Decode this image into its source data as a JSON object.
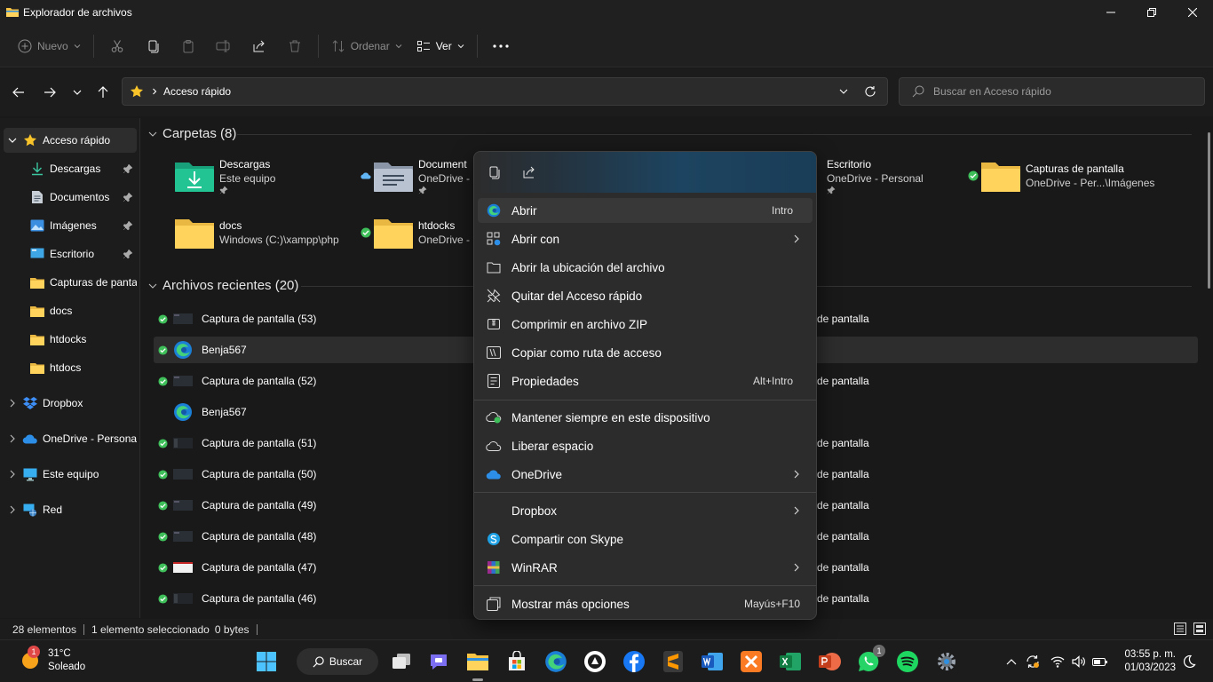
{
  "window": {
    "title": "Explorador de archivos"
  },
  "toolbar": {
    "new_label": "Nuevo",
    "sort_label": "Ordenar",
    "view_label": "Ver"
  },
  "address": {
    "crumb": "Acceso rápido"
  },
  "search": {
    "placeholder": "Buscar en Acceso rápido"
  },
  "sidebar": {
    "items": [
      {
        "label": "Acceso rápido"
      },
      {
        "label": "Descargas"
      },
      {
        "label": "Documentos"
      },
      {
        "label": "Imágenes"
      },
      {
        "label": "Escritorio"
      },
      {
        "label": "Capturas de panta"
      },
      {
        "label": "docs"
      },
      {
        "label": "htdocks"
      },
      {
        "label": "htdocs"
      },
      {
        "label": "Dropbox"
      },
      {
        "label": "OneDrive - Personal"
      },
      {
        "label": "Este equipo"
      },
      {
        "label": "Red"
      }
    ]
  },
  "main": {
    "folders_header": "Carpetas (8)",
    "recent_header": "Archivos recientes (20)",
    "folders": [
      {
        "name": "Descargas",
        "sub": "Este equipo"
      },
      {
        "name": "Document",
        "sub": "OneDrive -"
      },
      {
        "name": "Escritorio",
        "sub": "OneDrive - Personal"
      },
      {
        "name": "Capturas de pantalla",
        "sub": "OneDrive - Per...\\Imágenes"
      },
      {
        "name": "docs",
        "sub": "Windows (C:)\\xampp\\php"
      },
      {
        "name": "htdocks",
        "sub": "OneDrive -"
      }
    ],
    "files": [
      {
        "name": "Captura de pantalla (53)",
        "right": "de pantalla"
      },
      {
        "name": "Benja567",
        "right": ""
      },
      {
        "name": "Captura de pantalla (52)",
        "right": "de pantalla"
      },
      {
        "name": "Benja567",
        "right": ""
      },
      {
        "name": "Captura de pantalla (51)",
        "right": "de pantalla"
      },
      {
        "name": "Captura de pantalla (50)",
        "right": "de pantalla"
      },
      {
        "name": "Captura de pantalla (49)",
        "right": "de pantalla"
      },
      {
        "name": "Captura de pantalla (48)",
        "right": "de pantalla"
      },
      {
        "name": "Captura de pantalla (47)",
        "right": "de pantalla"
      },
      {
        "name": "Captura de pantalla (46)",
        "right": "de pantalla"
      }
    ]
  },
  "context_menu": {
    "items": [
      {
        "label": "Abrir",
        "shortcut": "Intro"
      },
      {
        "label": "Abrir con"
      },
      {
        "label": "Abrir la ubicación del archivo"
      },
      {
        "label": "Quitar del Acceso rápido"
      },
      {
        "label": "Comprimir en archivo ZIP"
      },
      {
        "label": "Copiar como ruta de acceso"
      },
      {
        "label": "Propiedades",
        "shortcut": "Alt+Intro"
      },
      {
        "label": "Mantener siempre en este dispositivo"
      },
      {
        "label": "Liberar espacio"
      },
      {
        "label": "OneDrive"
      },
      {
        "label": "Dropbox"
      },
      {
        "label": "Compartir con Skype"
      },
      {
        "label": "WinRAR"
      },
      {
        "label": "Mostrar más opciones",
        "shortcut": "Mayús+F10"
      }
    ]
  },
  "status": {
    "count": "28 elementos",
    "selected": "1 elemento seleccionado",
    "size": "0 bytes"
  },
  "taskbar": {
    "weather_temp": "31°C",
    "weather_desc": "Soleado",
    "weather_badge": "1",
    "search_label": "Buscar",
    "whatsapp_badge": "1",
    "time": "03:55 p. m.",
    "date": "01/03/2023"
  },
  "colors": {
    "accent": "#0078d4",
    "folder": "#ffd35c",
    "sync_green": "#3fbf5a",
    "background": "#191919"
  }
}
